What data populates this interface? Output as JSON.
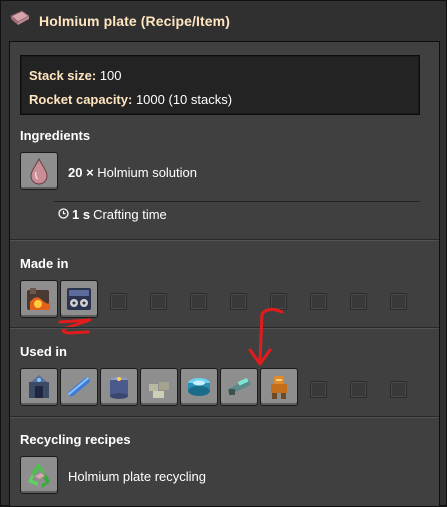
{
  "window": {
    "title": "Holmium plate (Recipe/Item)",
    "icon": "holmium-plate-icon"
  },
  "stats": {
    "stack_size_label": "Stack size:",
    "stack_size_value": "100",
    "rocket_capacity_label": "Rocket capacity:",
    "rocket_capacity_value": "1000 (10 stacks)"
  },
  "ingredients": {
    "title": "Ingredients",
    "items": [
      {
        "amount": "20 ×",
        "name": "Holmium solution",
        "icon": "holmium-solution-icon"
      }
    ],
    "crafting_time": {
      "value": "1 s",
      "label": "Crafting time",
      "icon": "clock-icon"
    }
  },
  "made_in": {
    "title": "Made in",
    "items": [
      {
        "icon": "foundry-icon"
      },
      {
        "icon": "assembling-machine-icon"
      }
    ]
  },
  "used_in": {
    "title": "Used in",
    "items": [
      {
        "icon": "electromagnetic-plant-icon"
      },
      {
        "icon": "superconductor-icon"
      },
      {
        "icon": "supercapacitor-icon"
      },
      {
        "icon": "stone-icon"
      },
      {
        "icon": "lens-icon"
      },
      {
        "icon": "railgun-icon"
      },
      {
        "icon": "mech-armor-icon"
      }
    ]
  },
  "recycling": {
    "title": "Recycling recipes",
    "items": [
      {
        "name": "Holmium plate recycling",
        "icon": "recycling-icon"
      }
    ]
  },
  "colors": {
    "title_text": "#ffe6c0",
    "annotation": "#e21c1c"
  }
}
